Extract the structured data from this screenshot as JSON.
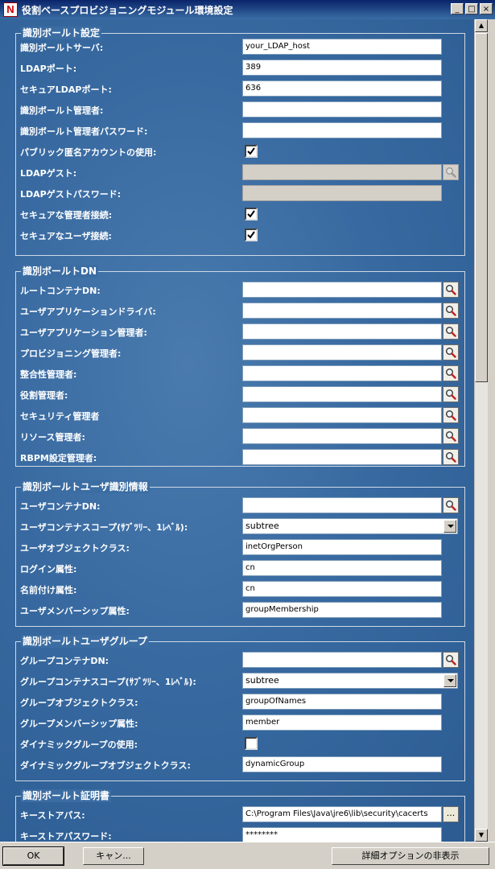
{
  "window": {
    "title": "役割ベースプロビジョニングモジュール環境設定",
    "icon_letter": "N",
    "minimize": "_",
    "maximize": "□",
    "close": "×"
  },
  "sections": [
    {
      "id": "vault",
      "title": "識別ボールト設定",
      "rows": [
        {
          "id": "vault-server",
          "label": "識別ボールトサーバ:",
          "type": "text",
          "value": "your_LDAP_host"
        },
        {
          "id": "ldap-port",
          "label": "LDAPポート:",
          "type": "text",
          "value": "389"
        },
        {
          "id": "secure-ldap-port",
          "label": "セキュアLDAPポート:",
          "type": "text",
          "value": "636"
        },
        {
          "id": "vault-admin",
          "label": "識別ボールト管理者:",
          "type": "text",
          "value": ""
        },
        {
          "id": "vault-admin-password",
          "label": "識別ボールト管理者パスワード:",
          "type": "text",
          "value": ""
        },
        {
          "id": "public-anonymous",
          "label": "パブリック匿名アカウントの使用:",
          "type": "checkbox",
          "checked": true
        },
        {
          "id": "ldap-guest",
          "label": "LDAPゲスト:",
          "type": "pick-disabled",
          "value": ""
        },
        {
          "id": "ldap-guest-password",
          "label": "LDAPゲストパスワード:",
          "type": "text-disabled",
          "value": ""
        },
        {
          "id": "secure-admin-connection",
          "label": "セキュアな管理者接続:",
          "type": "checkbox",
          "checked": true
        },
        {
          "id": "secure-user-connection",
          "label": "セキュアなユーザ接続:",
          "type": "checkbox",
          "checked": true
        }
      ]
    },
    {
      "id": "dn",
      "title": "識別ボールトDN",
      "rows": [
        {
          "id": "root-container-dn",
          "label": "ルートコンテナDN:",
          "type": "pick",
          "value": ""
        },
        {
          "id": "user-app-driver",
          "label": "ユーザアプリケーションドライバ:",
          "type": "pick",
          "value": ""
        },
        {
          "id": "user-app-admin",
          "label": "ユーザアプリケーション管理者:",
          "type": "pick",
          "value": ""
        },
        {
          "id": "provisioning-admin",
          "label": "プロビジョニング管理者:",
          "type": "pick",
          "value": ""
        },
        {
          "id": "compliance-admin",
          "label": "整合性管理者:",
          "type": "pick",
          "value": ""
        },
        {
          "id": "role-admin",
          "label": "役割管理者:",
          "type": "pick",
          "value": ""
        },
        {
          "id": "security-admin",
          "label": "セキュリティ管理者",
          "type": "pick",
          "value": ""
        },
        {
          "id": "resource-admin",
          "label": "リソース管理者:",
          "type": "pick",
          "value": ""
        },
        {
          "id": "rbpm-config-admin",
          "label": "RBPM設定管理者:",
          "type": "pick",
          "value": ""
        }
      ]
    },
    {
      "id": "user-identity",
      "title": "識別ボールトユーザ識別情報",
      "rows": [
        {
          "id": "user-container-dn",
          "label": "ユーザコンテナDN:",
          "type": "pick",
          "value": ""
        },
        {
          "id": "user-container-scope",
          "label": "ユーザコンテナスコープ(ｻﾌﾞﾂﾘｰ、1ﾚﾍﾞﾙ):",
          "type": "select",
          "value": "subtree"
        },
        {
          "id": "user-object-class",
          "label": "ユーザオブジェクトクラス:",
          "type": "text",
          "value": "inetOrgPerson"
        },
        {
          "id": "login-attribute",
          "label": "ログイン属性:",
          "type": "text",
          "value": "cn"
        },
        {
          "id": "naming-attribute",
          "label": "名前付け属性:",
          "type": "text",
          "value": "cn"
        },
        {
          "id": "user-membership-attribute",
          "label": "ユーザメンバーシップ属性:",
          "type": "text",
          "value": "groupMembership"
        }
      ]
    },
    {
      "id": "user-group",
      "title": "識別ボールトユーザグループ",
      "rows": [
        {
          "id": "group-container-dn",
          "label": "グループコンテナDN:",
          "type": "pick",
          "value": ""
        },
        {
          "id": "group-container-scope",
          "label": "グループコンテナスコープ(ｻﾌﾞﾂﾘｰ、1ﾚﾍﾞﾙ):",
          "type": "select",
          "value": "subtree"
        },
        {
          "id": "group-object-class",
          "label": "グループオブジェクトクラス:",
          "type": "text",
          "value": "groupOfNames"
        },
        {
          "id": "group-membership-attribute",
          "label": "グループメンバーシップ属性:",
          "type": "text",
          "value": "member"
        },
        {
          "id": "use-dynamic-groups",
          "label": "ダイナミックグループの使用:",
          "type": "checkbox",
          "checked": false
        },
        {
          "id": "dynamic-group-object-class",
          "label": "ダイナミックグループオブジェクトクラス:",
          "type": "text",
          "value": "dynamicGroup"
        }
      ]
    },
    {
      "id": "certificates",
      "title": "識別ボールト証明書",
      "rows": [
        {
          "id": "keystore-path",
          "label": "キーストアパス:",
          "type": "ellipsis",
          "value": "C:\\Program Files\\Java\\jre6\\lib\\security\\cacerts",
          "button": "..."
        },
        {
          "id": "keystore-password",
          "label": "キーストアパスワード:",
          "type": "text",
          "value": "********"
        }
      ]
    }
  ],
  "footer": {
    "ok": "OK",
    "cancel": "キャン...",
    "advanced": "詳細オプションの非表示"
  }
}
